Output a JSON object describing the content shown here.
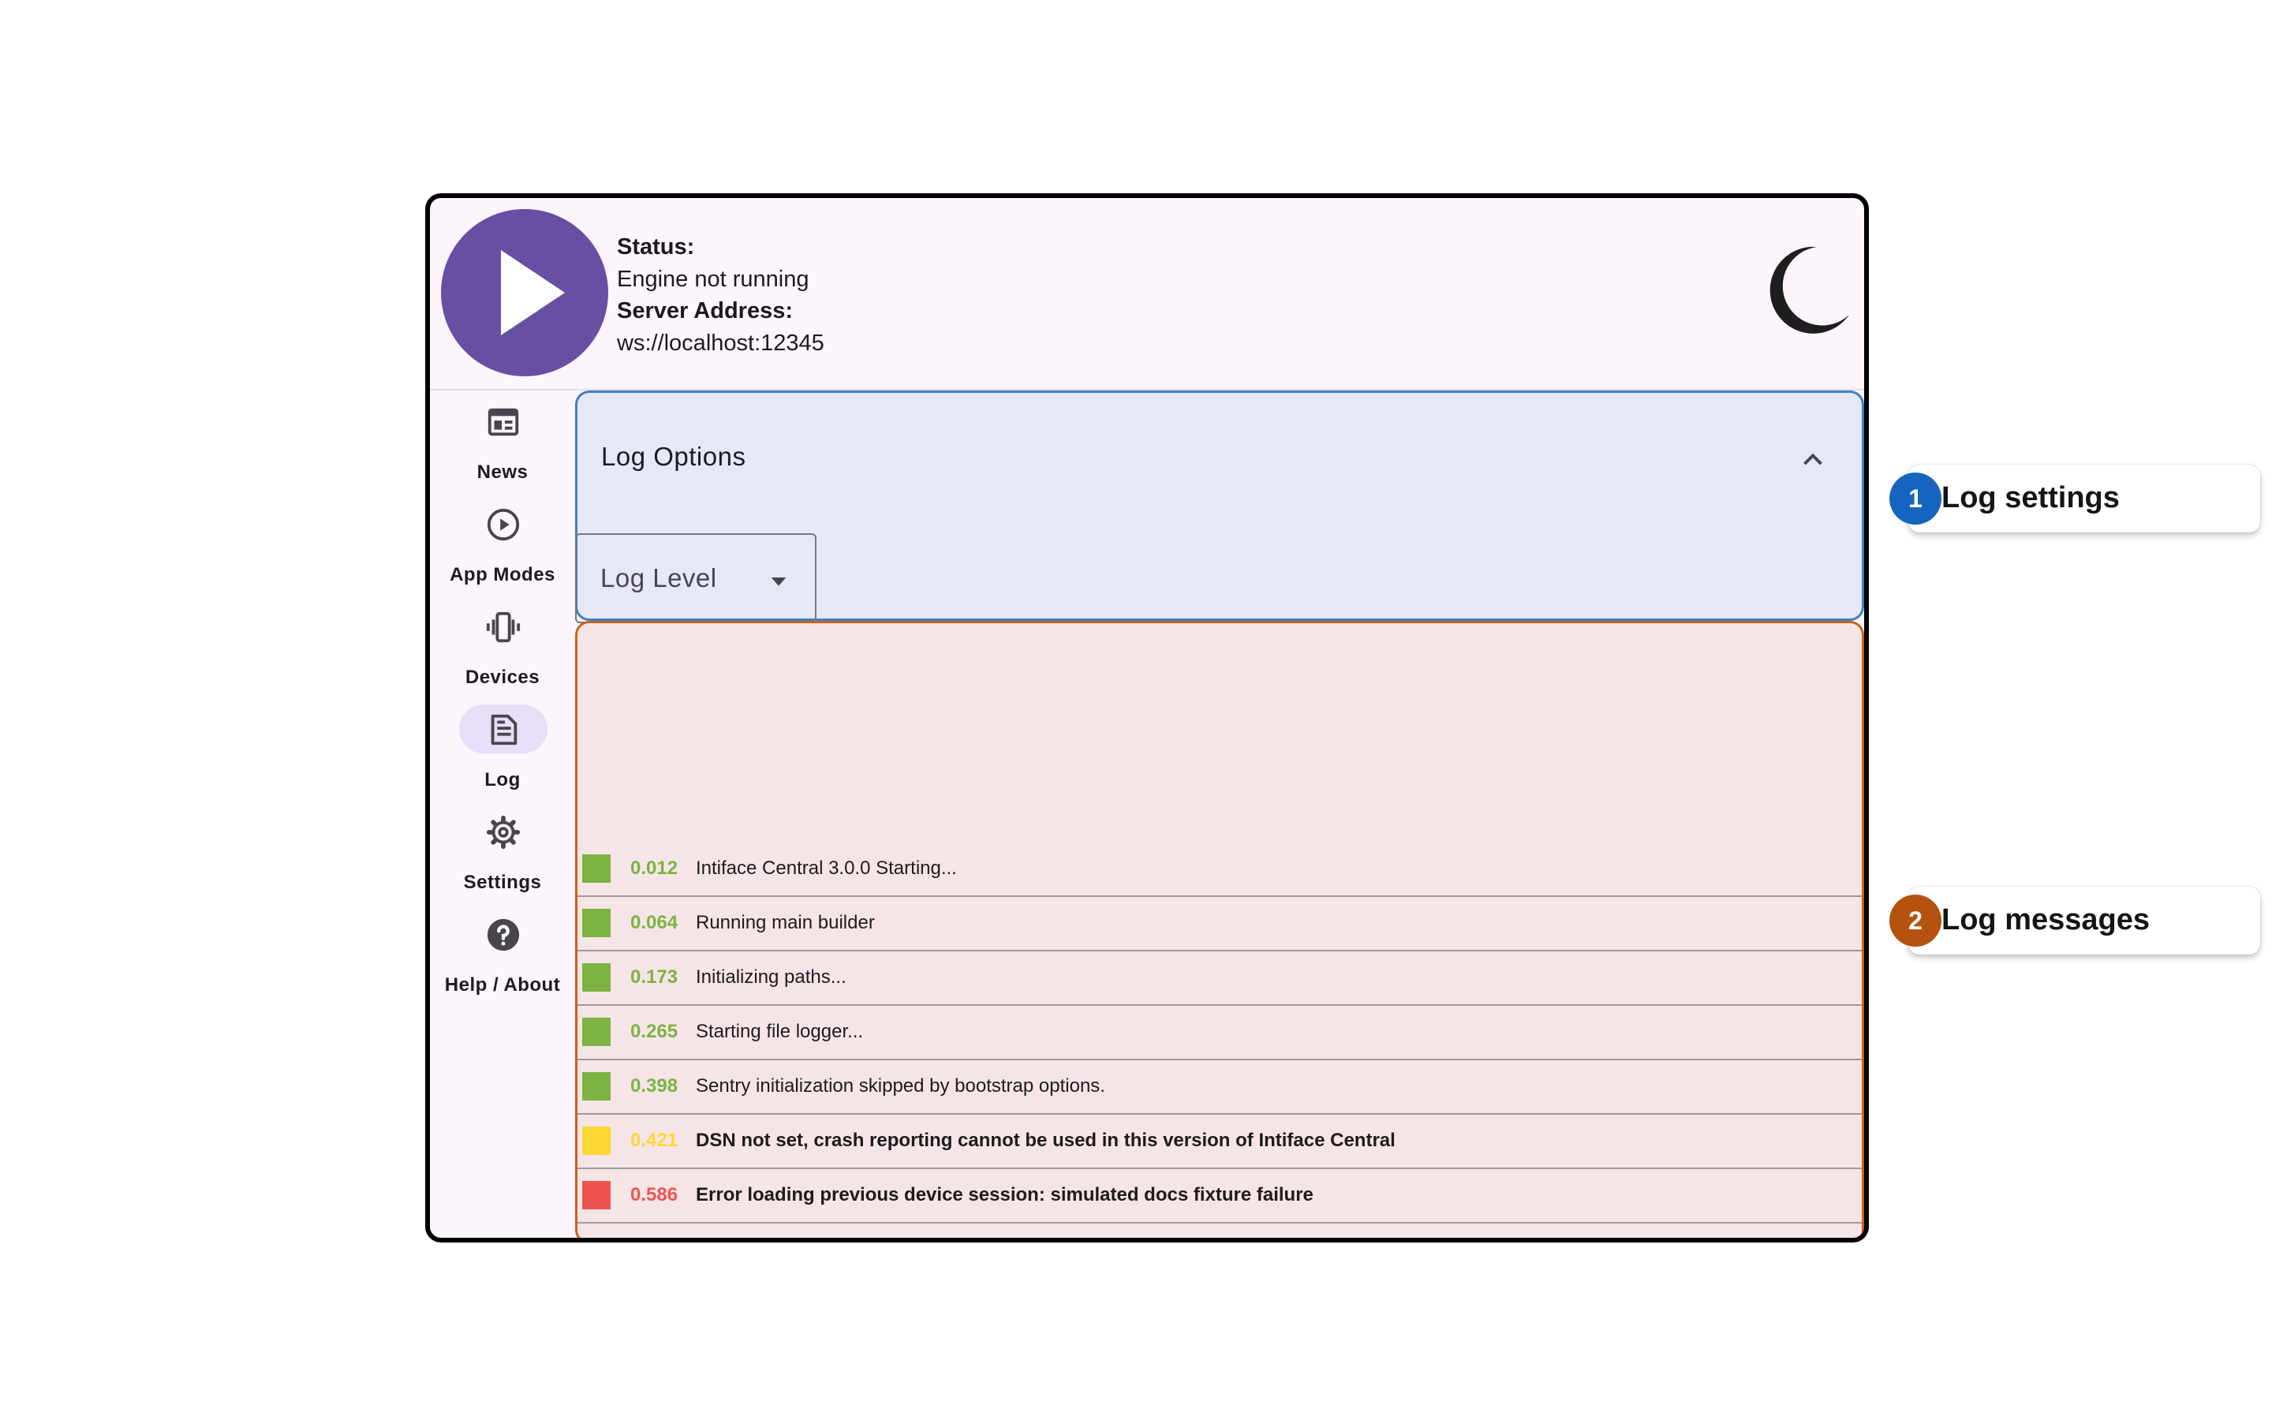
{
  "header": {
    "status_label": "Status:",
    "status_value": "Engine not running",
    "server_label": "Server Address:",
    "server_value": "ws://localhost:12345",
    "play_icon": "play-icon",
    "theme_icon": "moon-icon"
  },
  "nav": {
    "items": [
      {
        "label": "News",
        "icon": "news-icon"
      },
      {
        "label": "App Modes",
        "icon": "play-circle-icon"
      },
      {
        "label": "Devices",
        "icon": "vibration-icon"
      },
      {
        "label": "Log",
        "icon": "document-icon",
        "active": true
      },
      {
        "label": "Settings",
        "icon": "gear-icon"
      },
      {
        "label": "Help / About",
        "icon": "help-icon"
      }
    ]
  },
  "log_options": {
    "title": "Log Options",
    "level_label": "Log Level"
  },
  "log_messages": [
    {
      "time": "0.012",
      "text": "Intiface Central 3.0.0 Starting...",
      "level": "info"
    },
    {
      "time": "0.064",
      "text": "Running main builder",
      "level": "info"
    },
    {
      "time": "0.173",
      "text": "Initializing paths...",
      "level": "info"
    },
    {
      "time": "0.265",
      "text": "Starting file logger...",
      "level": "info"
    },
    {
      "time": "0.398",
      "text": "Sentry initialization skipped by bootstrap options.",
      "level": "info"
    },
    {
      "time": "0.421",
      "text": "DSN not set, crash reporting cannot be used in this version of Intiface Central",
      "level": "warning"
    },
    {
      "time": "0.586",
      "text": "Error loading previous device session: simulated docs fixture failure",
      "level": "error"
    }
  ],
  "callouts": [
    {
      "number": "1",
      "text": "Log settings",
      "color": "#1565c0"
    },
    {
      "number": "2",
      "text": "Log messages",
      "color": "#b5520f"
    }
  ],
  "colors": {
    "accent": "#6750a4",
    "info": "#7cb342",
    "warning": "#fdd835",
    "error": "#ef5350",
    "options_border": "#3f7fc4",
    "messages_border": "#c8621c"
  }
}
